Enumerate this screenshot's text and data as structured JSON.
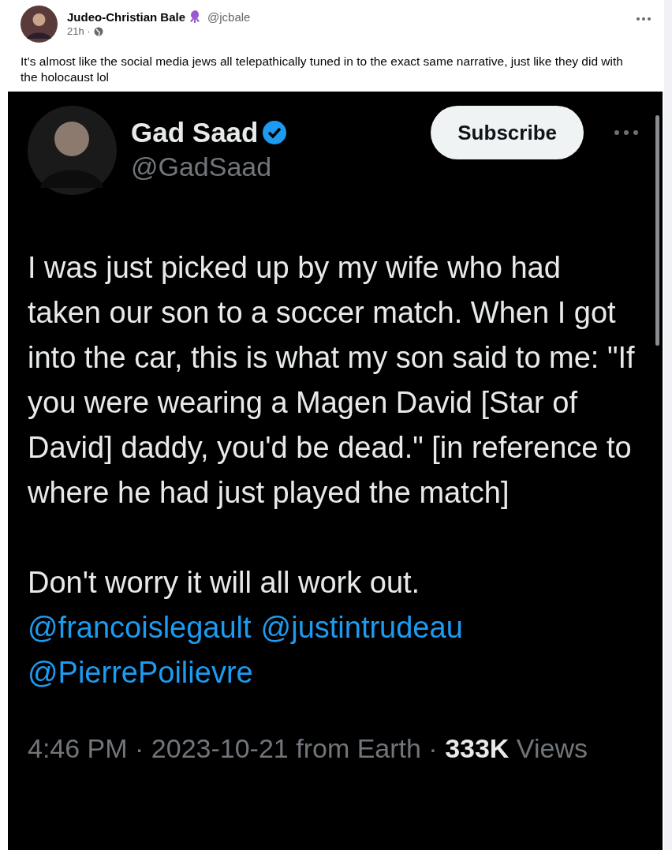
{
  "post": {
    "author": {
      "name": "Judeo-Christian Bale",
      "handle": "@jcbale"
    },
    "time": "21h ·",
    "text": "It’s almost like the social media jews all telepathically tuned in to the exact same narrative, just like they did with the holocaust lol"
  },
  "embed": {
    "author": {
      "name": "Gad Saad",
      "verified": true,
      "handle": "@GadSaad"
    },
    "subscribe": "Subscribe",
    "paragraphs": [
      "I was just picked up by my wife who had taken our son to a soccer match.  When I got into the car, this is what my son said to me:  \"If you were wearing a Magen David [Star of David] daddy, you'd be dead.\"  [in reference to where he had just played the match]",
      "Don't worry it will all work out."
    ],
    "links": [
      "@francoislegault",
      "@justintrudeau",
      "@PierrePoilievre"
    ],
    "footer": "4:46 PM · 2023-10-21 from Earth · **333K** Views"
  }
}
